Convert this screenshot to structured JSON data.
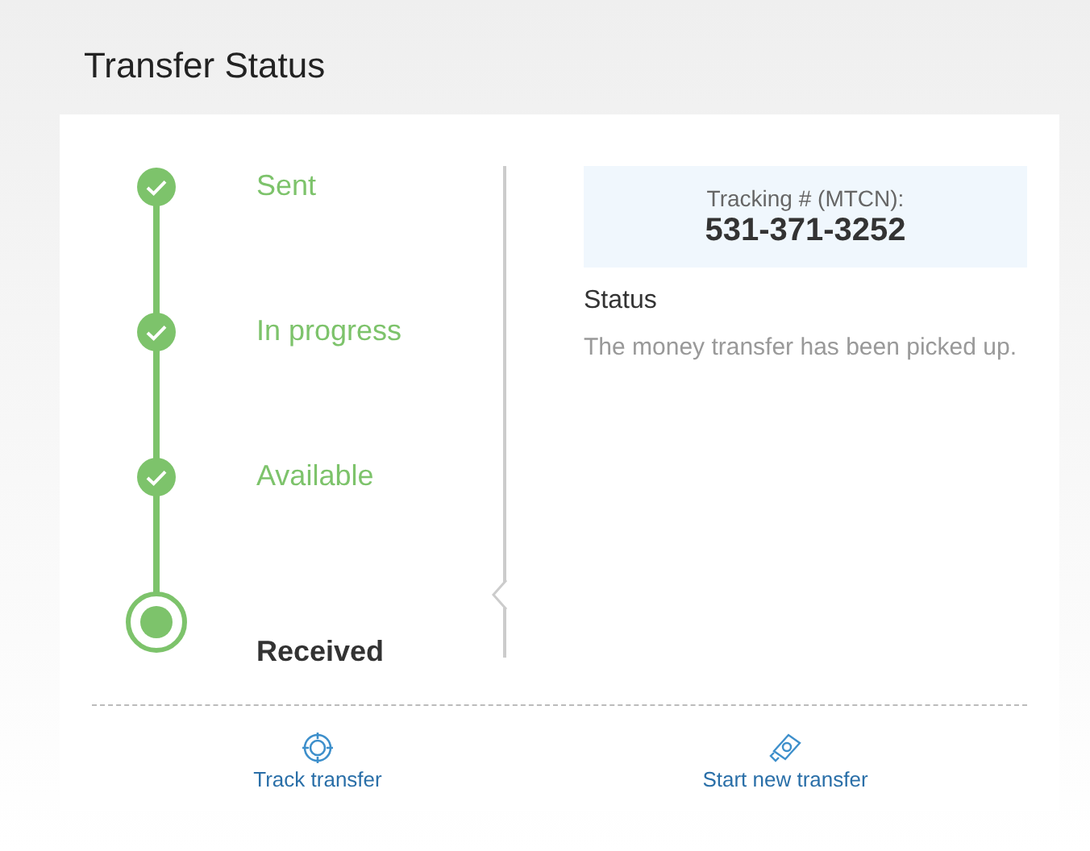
{
  "page_title": "Transfer Status",
  "steps": [
    {
      "label": "Sent",
      "kind": "done"
    },
    {
      "label": "In progress",
      "kind": "done"
    },
    {
      "label": "Available",
      "kind": "done"
    },
    {
      "label": "Received",
      "kind": "current"
    }
  ],
  "tracking": {
    "label": "Tracking # (MTCN):",
    "number": "531-371-3252"
  },
  "status": {
    "heading": "Status",
    "message": "The money transfer has been picked up."
  },
  "actions": [
    {
      "label": "Track transfer",
      "kind": "track"
    },
    {
      "label": "Start new transfer",
      "kind": "new"
    }
  ]
}
